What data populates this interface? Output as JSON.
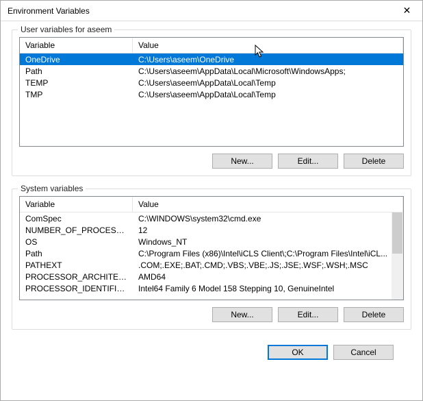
{
  "dialog": {
    "title": "Environment Variables",
    "close_symbol": "✕"
  },
  "userSection": {
    "legend": "User variables for aseem",
    "headers": {
      "variable": "Variable",
      "value": "Value"
    },
    "rows": [
      {
        "variable": "OneDrive",
        "value": "C:\\Users\\aseem\\OneDrive",
        "selected": true
      },
      {
        "variable": "Path",
        "value": "C:\\Users\\aseem\\AppData\\Local\\Microsoft\\WindowsApps;",
        "selected": false
      },
      {
        "variable": "TEMP",
        "value": "C:\\Users\\aseem\\AppData\\Local\\Temp",
        "selected": false
      },
      {
        "variable": "TMP",
        "value": "C:\\Users\\aseem\\AppData\\Local\\Temp",
        "selected": false
      }
    ],
    "buttons": {
      "new": "New...",
      "edit": "Edit...",
      "delete": "Delete"
    }
  },
  "systemSection": {
    "legend": "System variables",
    "headers": {
      "variable": "Variable",
      "value": "Value"
    },
    "rows": [
      {
        "variable": "ComSpec",
        "value": "C:\\WINDOWS\\system32\\cmd.exe"
      },
      {
        "variable": "NUMBER_OF_PROCESSORS",
        "value": "12"
      },
      {
        "variable": "OS",
        "value": "Windows_NT"
      },
      {
        "variable": "Path",
        "value": "C:\\Program Files (x86)\\Intel\\iCLS Client\\;C:\\Program Files\\Intel\\iCL..."
      },
      {
        "variable": "PATHEXT",
        "value": ".COM;.EXE;.BAT;.CMD;.VBS;.VBE;.JS;.JSE;.WSF;.WSH;.MSC"
      },
      {
        "variable": "PROCESSOR_ARCHITECTURE",
        "value": "AMD64"
      },
      {
        "variable": "PROCESSOR_IDENTIFIER",
        "value": "Intel64 Family 6 Model 158 Stepping 10, GenuineIntel"
      }
    ],
    "buttons": {
      "new": "New...",
      "edit": "Edit...",
      "delete": "Delete"
    }
  },
  "dialogButtons": {
    "ok": "OK",
    "cancel": "Cancel"
  }
}
